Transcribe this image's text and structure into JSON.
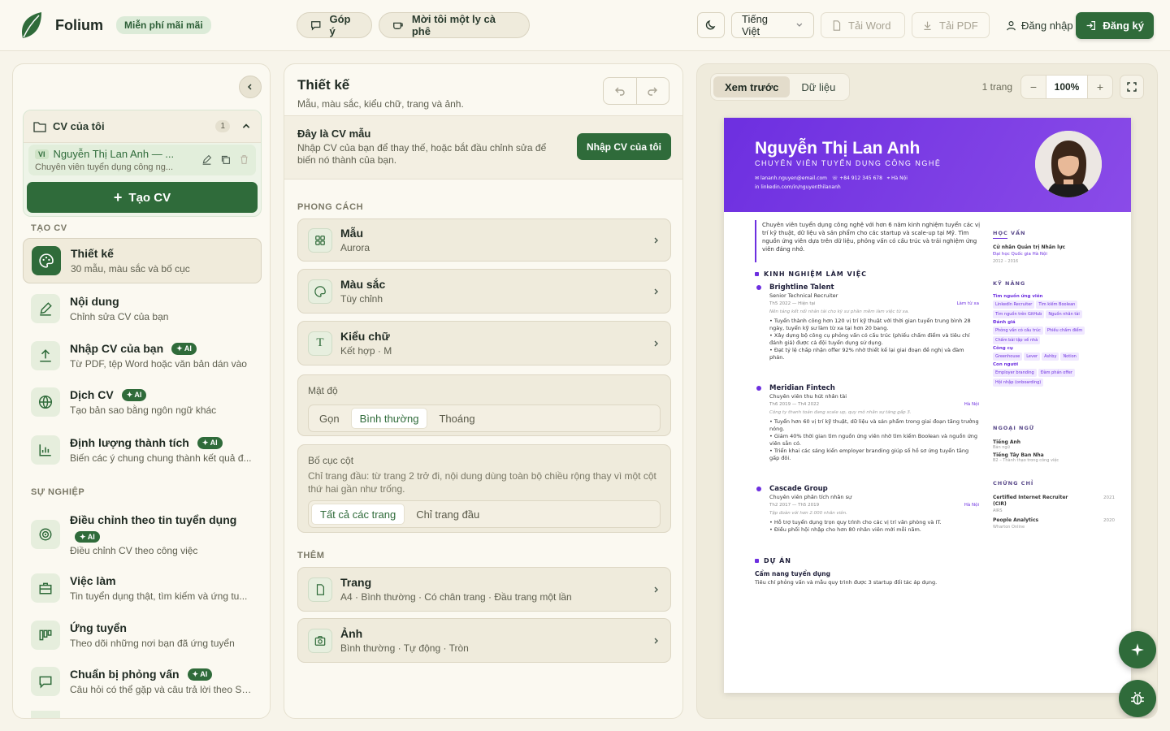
{
  "topbar": {
    "brand": "Folium",
    "free_badge": "Miễn phí mãi mãi",
    "feedback": "Góp ý",
    "coffee": "Mời tôi một ly cà phê",
    "language": "Tiếng Việt",
    "download_word": "Tải Word",
    "download_pdf": "Tải PDF",
    "login": "Đăng nhập",
    "signup": "Đăng ký"
  },
  "sidebar": {
    "my_cvs": {
      "title": "CV của tôi",
      "count": "1"
    },
    "cv_item": {
      "lang": "VI",
      "name": "Nguyễn Thị Lan Anh — ...",
      "sub": "Chuyên viên tuyển dụng công ng..."
    },
    "create_label": "Tạo CV",
    "section_create": "TẠO CV",
    "section_career": "SỰ NGHIỆP",
    "ai_label": "AI",
    "items": [
      {
        "title": "Thiết kế",
        "desc": "30 mẫu, màu sắc và bố cục"
      },
      {
        "title": "Nội dung",
        "desc": "Chỉnh sửa CV của bạn"
      },
      {
        "title": "Nhập CV của bạn",
        "desc": "Từ PDF, tệp Word hoặc văn bản dán vào"
      },
      {
        "title": "Dịch CV",
        "desc": "Tạo bản sao bằng ngôn ngữ khác"
      },
      {
        "title": "Định lượng thành tích",
        "desc": "Biến các ý chung chung thành kết quả đ..."
      },
      {
        "title": "Điều chỉnh theo tin tuyển dụng",
        "desc": "Điều chỉnh CV theo công việc"
      },
      {
        "title": "Việc làm",
        "desc": "Tin tuyển dụng thật, tìm kiếm và ứng tu..."
      },
      {
        "title": "Ứng tuyển",
        "desc": "Theo dõi những nơi bạn đã ứng tuyển"
      },
      {
        "title": "Chuẩn bị phỏng vấn",
        "desc": "Câu hỏi có thể gặp và câu trả lời theo ST..."
      }
    ]
  },
  "design": {
    "title": "Thiết kế",
    "subtitle": "Mẫu, màu sắc, kiểu chữ, trang và ảnh.",
    "sample_title": "Đây là CV mẫu",
    "sample_desc": "Nhập CV của bạn để thay thế, hoặc bắt đầu chỉnh sửa để biến nó thành của bạn.",
    "import_btn": "Nhập CV của tôi",
    "style_section": "PHONG CÁCH",
    "template": {
      "title": "Mẫu",
      "value": "Aurora"
    },
    "color": {
      "title": "Màu sắc",
      "value": "Tùy chỉnh"
    },
    "font": {
      "title": "Kiểu chữ",
      "value": "Kết hợp · M"
    },
    "density": {
      "label": "Mật độ",
      "options": [
        "Gọn",
        "Bình thường",
        "Thoáng"
      ],
      "selected": "Bình thường"
    },
    "columns": {
      "label": "Bố cục cột",
      "desc": "Chỉ trang đầu: từ trang 2 trở đi, nội dung dùng toàn bộ chiều rộng thay vì một cột thứ hai gần như trống.",
      "options": [
        "Tất cả các trang",
        "Chỉ trang đầu"
      ],
      "selected": "Tất cả các trang"
    },
    "more_section": "THÊM",
    "page": {
      "title": "Trang",
      "value": "A4 · Bình thường · Có chân trang · Đầu trang một lần"
    },
    "photo": {
      "title": "Ảnh",
      "value": "Bình thường · Tự động · Tròn"
    }
  },
  "preview": {
    "tab_preview": "Xem trước",
    "tab_data": "Dữ liệu",
    "pages": "1 trang",
    "zoom": "100%",
    "cv": {
      "name": "Nguyễn Thị Lan Anh",
      "role": "CHUYÊN VIÊN TUYỂN DỤNG CÔNG NGHỆ",
      "email": "lananh.nguyen@email.com",
      "phone": "+84 912 345 678",
      "location": "Hà Nội",
      "linkedin": "linkedin.com/in/nguyenthilananh",
      "summary": "Chuyên viên tuyển dụng công nghệ với hơn 6 năm kinh nghiệm tuyển các vị trí kỹ thuật, dữ liệu và sản phẩm cho các startup và scale-up tại Mỹ. Tìm nguồn ứng viên dựa trên dữ liệu, phỏng vấn có cấu trúc và trải nghiệm ứng viên đáng nhớ.",
      "exp_title": "KINH NGHIỆM LÀM VIỆC",
      "jobs": [
        {
          "company": "Brightline Talent",
          "title": "Senior Technical Recruiter",
          "date": "Th5 2022 — Hiện tại",
          "loc": "Làm từ xa",
          "note": "Nền tảng kết nối nhân tài cho kỹ sư phần mềm làm việc từ xa.",
          "bullets": [
            "Tuyển thành công hơn 120 vị trí kỹ thuật với thời gian tuyển trung bình 28 ngày, tuyển kỹ sư làm từ xa tại hơn 20 bang.",
            "Xây dựng bộ công cụ phỏng vấn có cấu trúc (phiếu chấm điểm và tiêu chí đánh giá) được cả đội tuyển dụng sử dụng.",
            "Đạt tỷ lệ chấp nhận offer 92% nhờ thiết kế lại giai đoạn đề nghị và đàm phán."
          ]
        },
        {
          "company": "Meridian Fintech",
          "title": "Chuyên viên thu hút nhân tài",
          "date": "Th6 2019 — Th4 2022",
          "loc": "Hà Nội",
          "note": "Công ty thanh toán đang scale up, quy mô nhân sự tăng gấp 3.",
          "bullets": [
            "Tuyển hơn 60 vị trí kỹ thuật, dữ liệu và sản phẩm trong giai đoạn tăng trưởng nóng.",
            "Giảm 40% thời gian tìm nguồn ứng viên nhờ tìm kiếm Boolean và nguồn ứng viên sẵn có.",
            "Triển khai các sáng kiến employer branding giúp số hồ sơ ứng tuyển tăng gấp đôi."
          ]
        },
        {
          "company": "Cascade Group",
          "title": "Chuyên viên phân tích nhân sự",
          "date": "Th2 2017 — Th5 2019",
          "loc": "Hà Nội",
          "note": "Tập đoàn với hơn 2.000 nhân viên.",
          "bullets": [
            "Hỗ trợ tuyển dụng trọn quy trình cho các vị trí văn phòng và IT.",
            "Điều phối hội nhập cho hơn 80 nhân viên mới mỗi năm."
          ]
        }
      ],
      "proj_title": "DỰ ÁN",
      "project": {
        "name": "Cẩm nang tuyển dụng",
        "desc": "Tiêu chí phỏng vấn và mẫu quy trình được 3 startup đối tác áp dụng."
      },
      "edu_title": "HỌC VẤN",
      "edu": {
        "degree": "Cử nhân Quản trị Nhân lực",
        "school": "Đại học Quốc gia Hà Nội",
        "years": "2012 – 2016"
      },
      "skills_title": "KỸ NĂNG",
      "skill_groups": [
        {
          "name": "Tìm nguồn ứng viên",
          "tags": [
            "LinkedIn Recruiter",
            "Tìm kiếm Boolean",
            "Tìm nguồn trên GitHub",
            "Nguồn nhân tài"
          ]
        },
        {
          "name": "Đánh giá",
          "tags": [
            "Phỏng vấn có cấu trúc",
            "Phiếu chấm điểm",
            "Chấm bài tập về nhà"
          ]
        },
        {
          "name": "Công cụ",
          "tags": [
            "Greenhouse",
            "Lever",
            "Ashby",
            "Notion"
          ]
        },
        {
          "name": "Con người",
          "tags": [
            "Employer branding",
            "Đàm phán offer",
            "Hội nhập (onboarding)"
          ]
        }
      ],
      "lang_title": "NGOẠI NGỮ",
      "languages": [
        {
          "name": "Tiếng Anh",
          "level": "Bản ngữ"
        },
        {
          "name": "Tiếng Tây Ban Nha",
          "level": "B2 – Thành thạo trong công việc"
        }
      ],
      "cert_title": "CHỨNG CHỈ",
      "certs": [
        {
          "name": "Certified Internet Recruiter (CIR)",
          "org": "AIRS",
          "year": "2021"
        },
        {
          "name": "People Analytics",
          "org": "Wharton Online",
          "year": "2020"
        }
      ]
    }
  },
  "colors": {
    "accent": "#2f6b3a",
    "cv_accent": "#6d2fe0"
  }
}
